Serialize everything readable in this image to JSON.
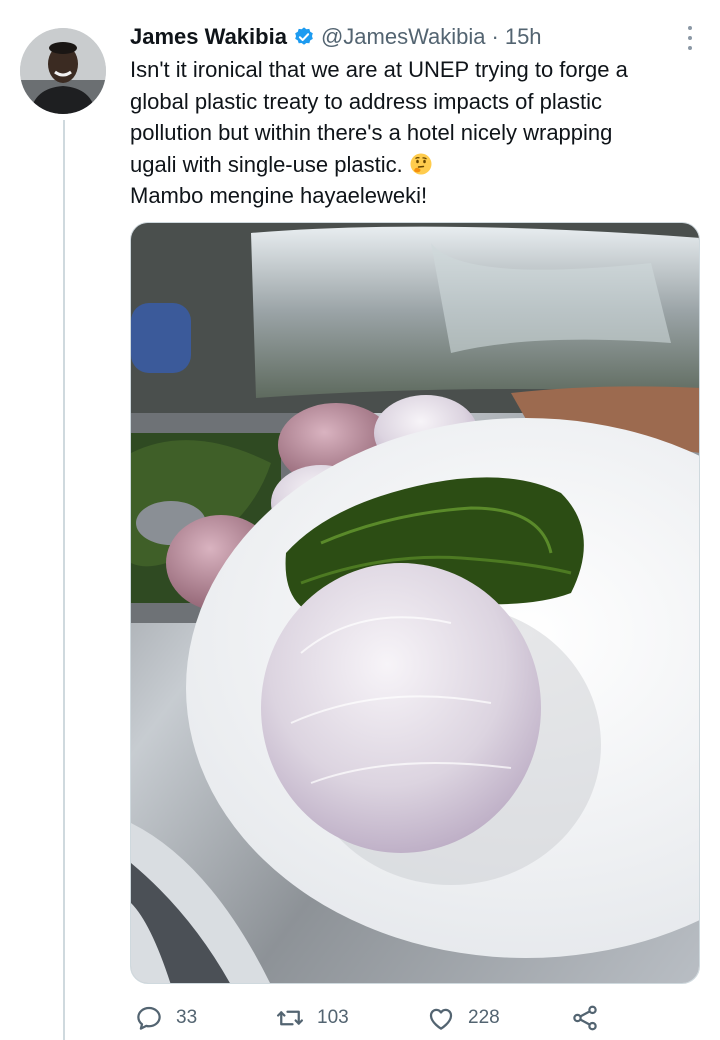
{
  "tweet": {
    "author_name": "James Wakibia",
    "handle": "@JamesWakibia",
    "separator": "·",
    "time": "15h",
    "text_lines": [
      "Isn't it  ironical that we are at UNEP trying to forge a",
      "global plastic treaty to address impacts of plastic",
      "pollution but within there's a hotel nicely wrapping",
      "ugali with single-use plastic.",
      "Mambo mengine hayaeleweki!"
    ],
    "emoji": "thinking-face",
    "verified": true
  },
  "actions": {
    "replies": "33",
    "retweets": "103",
    "likes": "228"
  },
  "icons": {
    "verified": "verified-badge-icon",
    "more": "more-options-icon",
    "reply": "reply-icon",
    "retweet": "retweet-icon",
    "like": "heart-icon",
    "share": "share-icon"
  },
  "colors": {
    "text": "#0f1419",
    "secondary": "#536471",
    "verified": "#1d9bf0",
    "border": "#cfd9de"
  }
}
